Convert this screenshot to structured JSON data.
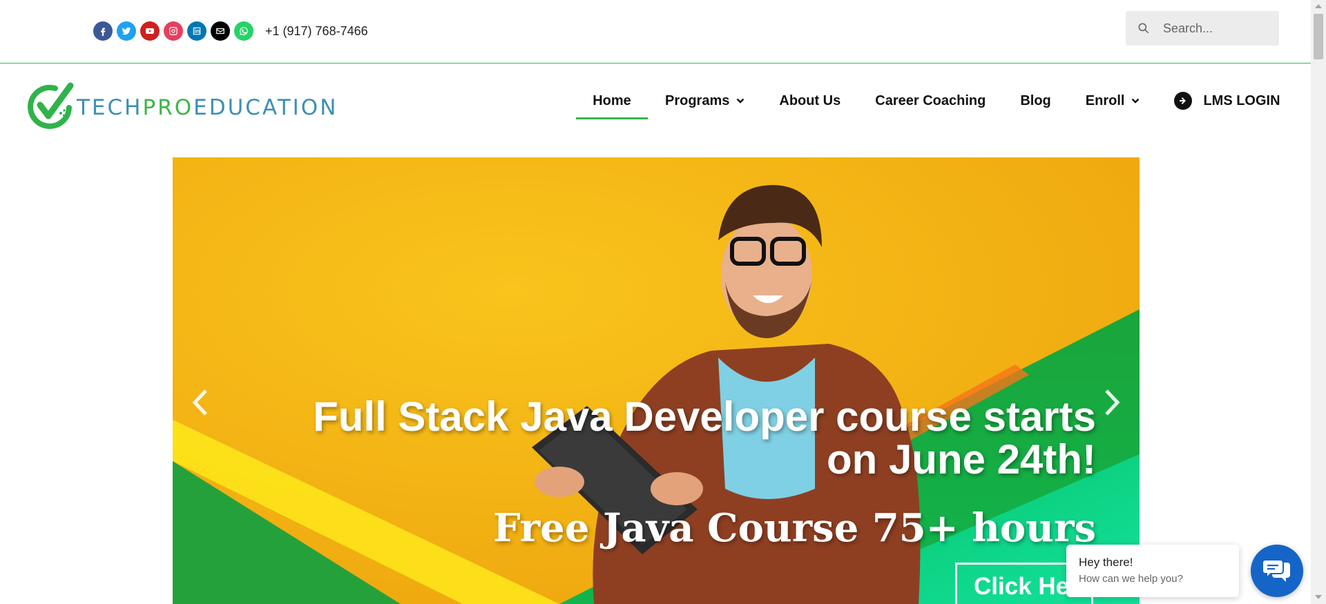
{
  "topbar": {
    "social_icons": [
      {
        "name": "facebook-icon",
        "color": "#3b5998"
      },
      {
        "name": "twitter-icon",
        "color": "#1da1f2"
      },
      {
        "name": "youtube-icon",
        "color": "#cd201f"
      },
      {
        "name": "instagram-icon",
        "color": "#e4405f"
      },
      {
        "name": "linkedin-icon",
        "color": "#0077b5"
      },
      {
        "name": "envelope-icon",
        "color": "#000000"
      },
      {
        "name": "whatsapp-icon",
        "color": "#25d366"
      }
    ],
    "phone": "+1 (917) 768-7466",
    "search_placeholder": "Search..."
  },
  "logo": {
    "part1": "TECH",
    "part2": "PRO",
    "part3": "EDUCATION"
  },
  "nav": {
    "home": "Home",
    "programs": "Programs",
    "about": "About Us",
    "career": "Career Coaching",
    "blog": "Blog",
    "enroll": "Enroll",
    "lms": "LMS LOGIN"
  },
  "hero": {
    "headline": "Full Stack Java Developer course starts on June 24th!",
    "subheadline": "Free Java Course 75+ hours",
    "cta": "Click Here"
  },
  "chat": {
    "title": "Hey there!",
    "subtitle": "How can we help you?"
  },
  "colors": {
    "accent": "#39b54a",
    "brand_blue": "#3d8fb4",
    "chat_blue": "#1565c8"
  }
}
